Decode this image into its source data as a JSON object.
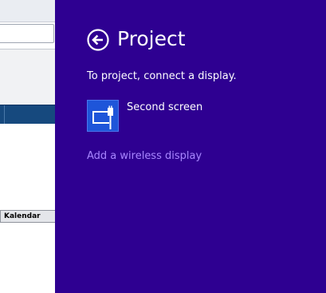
{
  "background_app": {
    "sheet_tab_label": "Kalendar"
  },
  "charm": {
    "title": "Project",
    "back_icon": "back-arrow-circle-icon",
    "subtitle": "To project, connect a display.",
    "options": [
      {
        "label": "Second screen",
        "icon": "second-screen-icon"
      }
    ],
    "add_wireless_label": "Add a wireless display",
    "colors": {
      "pane_background": "#2e0091",
      "tile_background": "#1e55d9",
      "link": "#a886ff"
    }
  }
}
